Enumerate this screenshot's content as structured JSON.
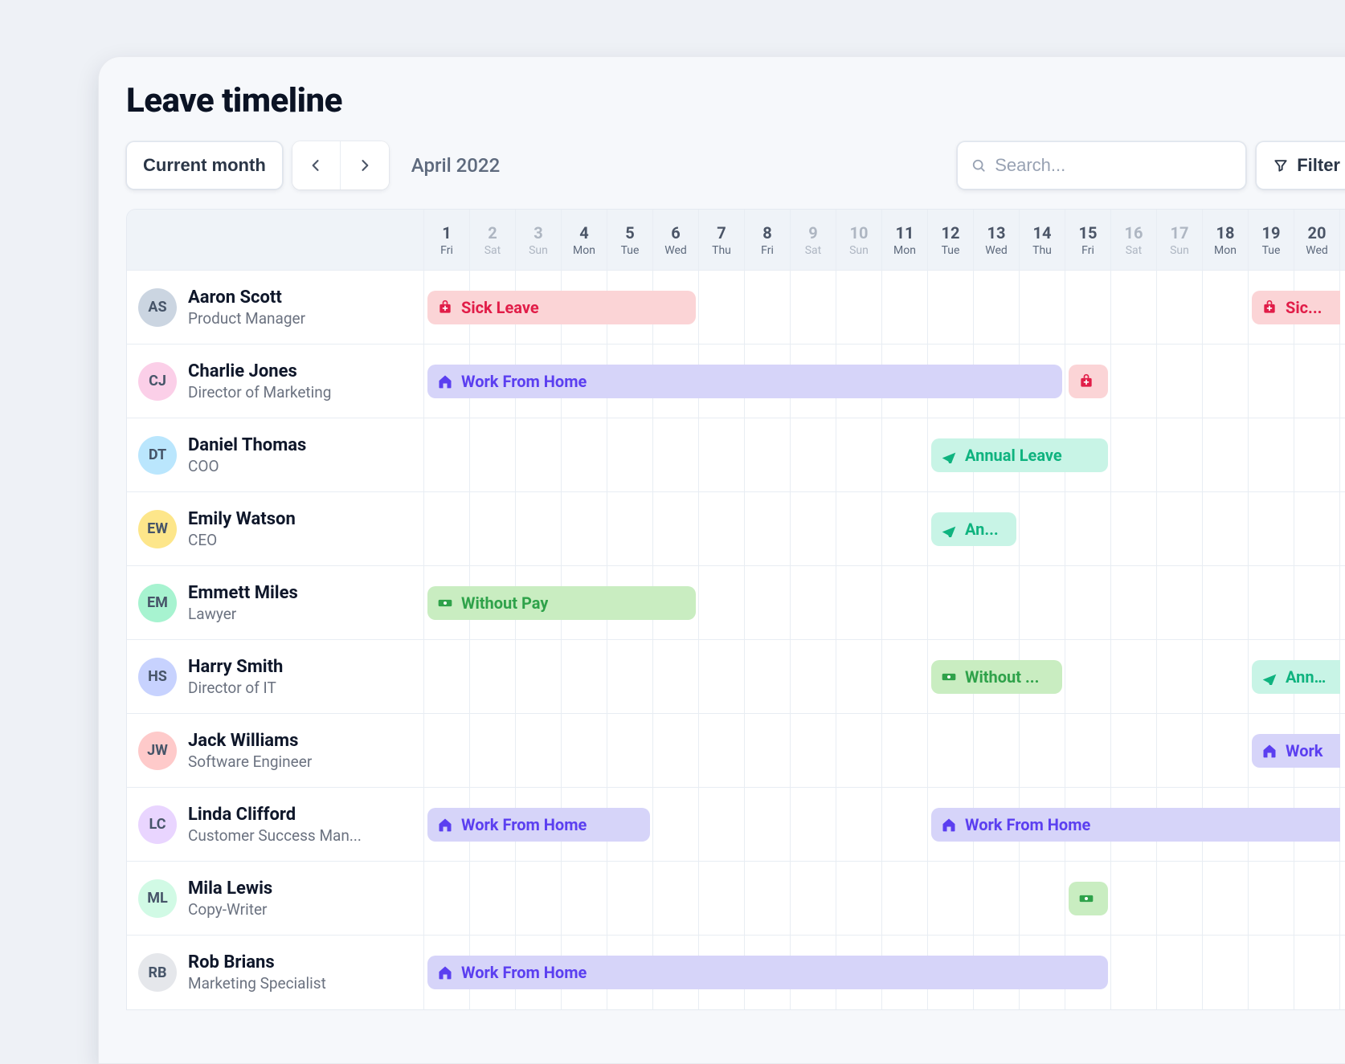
{
  "title": "Leave timeline",
  "toolbar": {
    "current_month_label": "Current month",
    "month_label": "April 2022",
    "search_placeholder": "Search...",
    "filter_label": "Filter"
  },
  "calendar": {
    "start_day": 1,
    "days": [
      {
        "num": "1",
        "dow": "Fri",
        "weekend": false
      },
      {
        "num": "2",
        "dow": "Sat",
        "weekend": true
      },
      {
        "num": "3",
        "dow": "Sun",
        "weekend": true
      },
      {
        "num": "4",
        "dow": "Mon",
        "weekend": false
      },
      {
        "num": "5",
        "dow": "Tue",
        "weekend": false
      },
      {
        "num": "6",
        "dow": "Wed",
        "weekend": false
      },
      {
        "num": "7",
        "dow": "Thu",
        "weekend": false
      },
      {
        "num": "8",
        "dow": "Fri",
        "weekend": false
      },
      {
        "num": "9",
        "dow": "Sat",
        "weekend": true
      },
      {
        "num": "10",
        "dow": "Sun",
        "weekend": true
      },
      {
        "num": "11",
        "dow": "Mon",
        "weekend": false
      },
      {
        "num": "12",
        "dow": "Tue",
        "weekend": false
      },
      {
        "num": "13",
        "dow": "Wed",
        "weekend": false
      },
      {
        "num": "14",
        "dow": "Thu",
        "weekend": false
      },
      {
        "num": "15",
        "dow": "Fri",
        "weekend": false
      },
      {
        "num": "16",
        "dow": "Sat",
        "weekend": true
      },
      {
        "num": "17",
        "dow": "Sun",
        "weekend": true
      },
      {
        "num": "18",
        "dow": "Mon",
        "weekend": false
      },
      {
        "num": "19",
        "dow": "Tue",
        "weekend": false
      },
      {
        "num": "20",
        "dow": "Wed",
        "weekend": false
      }
    ]
  },
  "avatar_bg": [
    "#cbd5e1",
    "#fbcfe8",
    "#bae6fd",
    "#fde68a",
    "#a7f3d0",
    "#c7d2fe",
    "#fecaca",
    "#e9d5ff",
    "#d1fae5",
    "#e5e7eb"
  ],
  "people": [
    {
      "name": "Aaron Scott",
      "role": "Product Manager",
      "events": [
        {
          "type": "sick",
          "label": "Sick Leave",
          "start": 1,
          "end": 6
        },
        {
          "type": "sick",
          "label": "Sic...",
          "start": 19,
          "end": 20,
          "clipRight": true
        }
      ]
    },
    {
      "name": "Charlie Jones",
      "role": "Director of Marketing",
      "events": [
        {
          "type": "wfh",
          "label": "Work From Home",
          "start": 1,
          "end": 14
        },
        {
          "type": "sick",
          "label": "",
          "start": 15,
          "end": 15
        }
      ]
    },
    {
      "name": "Daniel Thomas",
      "role": "COO",
      "events": [
        {
          "type": "annual",
          "label": "Annual Leave",
          "start": 12,
          "end": 15
        }
      ]
    },
    {
      "name": "Emily Watson",
      "role": "CEO",
      "events": [
        {
          "type": "annual",
          "label": "An...",
          "start": 12,
          "end": 13
        }
      ]
    },
    {
      "name": "Emmett Miles",
      "role": "Lawyer",
      "events": [
        {
          "type": "nopay",
          "label": "Without Pay",
          "start": 1,
          "end": 6
        }
      ]
    },
    {
      "name": "Harry Smith",
      "role": "Director of IT",
      "events": [
        {
          "type": "nopay",
          "label": "Without ...",
          "start": 12,
          "end": 14
        },
        {
          "type": "annual",
          "label": "Annual",
          "start": 19,
          "end": 20,
          "clipRight": true
        }
      ]
    },
    {
      "name": "Jack Williams",
      "role": "Software Engineer",
      "events": [
        {
          "type": "wfh",
          "label": "Work",
          "start": 19,
          "end": 20,
          "clipRight": true
        }
      ]
    },
    {
      "name": "Linda Clifford",
      "role": "Customer Success Man...",
      "events": [
        {
          "type": "wfh",
          "label": "Work From Home",
          "start": 1,
          "end": 5
        },
        {
          "type": "wfh",
          "label": "Work From Home",
          "start": 12,
          "end": 20,
          "clipRight": true
        }
      ]
    },
    {
      "name": "Mila Lewis",
      "role": "Copy-Writer",
      "events": [
        {
          "type": "nopay",
          "label": "",
          "start": 15,
          "end": 15
        }
      ]
    },
    {
      "name": "Rob Brians",
      "role": "Marketing Specialist",
      "events": [
        {
          "type": "wfh",
          "label": "Work From Home",
          "start": 1,
          "end": 15
        }
      ]
    }
  ],
  "icons": {
    "sick": "medkit-icon",
    "wfh": "home-icon",
    "annual": "plane-icon",
    "nopay": "cash-icon"
  },
  "colors": {
    "sick": {
      "bg": "#fbd4d6",
      "fg": "#e11d48"
    },
    "wfh": {
      "bg": "#d6d4f9",
      "fg": "#5b3ff0"
    },
    "annual": {
      "bg": "#c8f4e6",
      "fg": "#0fb37f"
    },
    "nopay": {
      "bg": "#c9edc1",
      "fg": "#2fa24a"
    }
  }
}
